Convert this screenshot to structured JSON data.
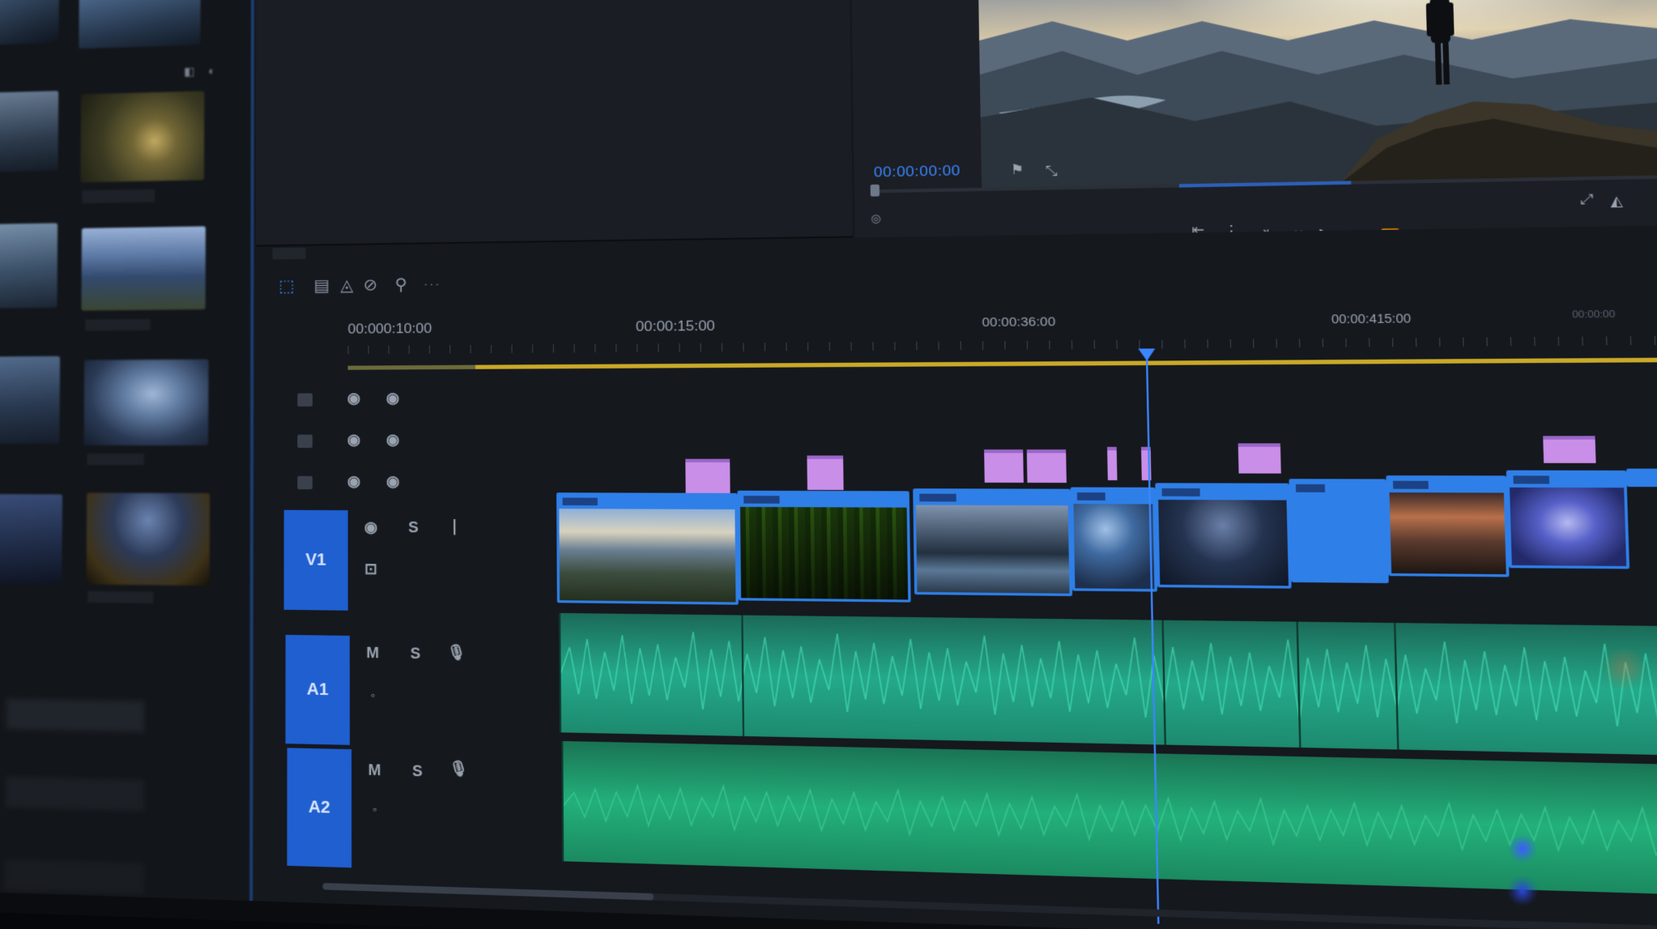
{
  "program_monitor": {
    "timecode": "00:00:00:00"
  },
  "timeline": {
    "ruler_timecodes": [
      "00:000:10:00",
      "00:00:15:00",
      "00:00:36:00",
      "00:00:415:00",
      "00:00:00"
    ],
    "tracks": {
      "video": [
        {
          "id": "v3",
          "label": ""
        },
        {
          "id": "v2",
          "label": ""
        },
        {
          "id": "v1b",
          "label": ""
        },
        {
          "id": "v1",
          "label": "V1"
        }
      ],
      "audio": [
        {
          "id": "a1",
          "label": "A1",
          "mute": "M",
          "solo": "S"
        },
        {
          "id": "a2",
          "label": "A2",
          "mute": "M",
          "solo": "S"
        }
      ],
      "v1_solo": "S"
    },
    "clip_count": 9
  },
  "colors": {
    "accent_blue": "#2f7fe8",
    "audio_green": "#2bd0a0",
    "work_area_yellow": "#c9a928",
    "fx_purple": "#c98ee8",
    "meter_green": "#2bd02f"
  },
  "icons": [
    "selection-tool-icon",
    "track-select-icon",
    "ripple-edit-icon",
    "razor-icon",
    "zoom-icon",
    "eye-icon",
    "lock-icon",
    "microphone-icon",
    "play-icon",
    "step-back-icon",
    "step-forward-icon",
    "marker-icon",
    "export-frame-icon"
  ]
}
